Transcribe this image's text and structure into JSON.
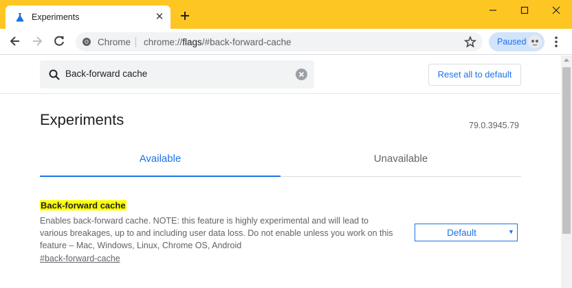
{
  "window": {
    "tab_title": "Experiments",
    "tab_close": "✕",
    "accent": "#fdc623"
  },
  "toolbar": {
    "omnibox_chip": "Chrome",
    "url_scheme": "chrome://",
    "url_host": "flags",
    "url_path": "/#back-forward-cache",
    "profile_status": "Paused"
  },
  "search": {
    "value": "Back-forward cache",
    "reset_label": "Reset all to default"
  },
  "main": {
    "title": "Experiments",
    "version": "79.0.3945.79",
    "tabs": [
      {
        "label": "Available",
        "active": true
      },
      {
        "label": "Unavailable",
        "active": false
      }
    ]
  },
  "flag": {
    "name": "Back-forward cache",
    "description_lines": [
      "Enables back-forward cache. NOTE: this feature is highly experimental and will lead to",
      "various breakages, up to and including user data loss. Do not enable unless you work on this",
      "feature – Mac, Windows, Linux, Chrome OS, Android"
    ],
    "anchor": "#back-forward-cache",
    "selected_option": "Default",
    "select_arrow": "▼"
  },
  "colors": {
    "link_blue": "#1a73e8",
    "highlight": "#ffff00",
    "text_secondary": "#5f6368"
  }
}
